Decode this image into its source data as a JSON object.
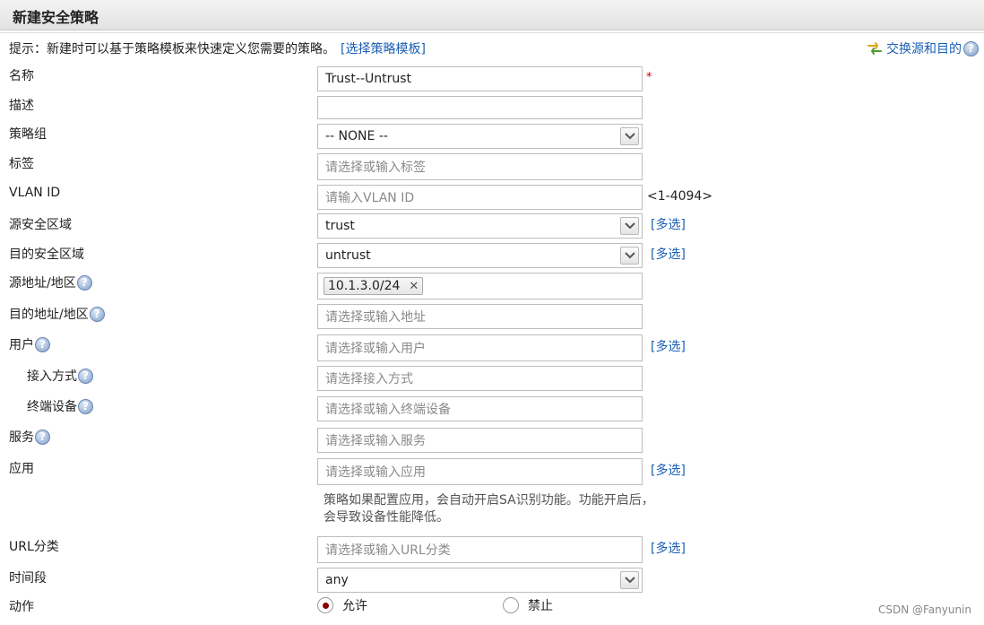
{
  "title": "新建安全策略",
  "hint": {
    "text": "提示：新建时可以基于策略模板来快速定义您需要的策略。",
    "template_link": "[选择策略模板]",
    "swap_label": "交换源和目的"
  },
  "colors": {
    "link": "#1a5fb4",
    "required": "#d00000",
    "radio_selected": "#8b0000"
  },
  "form": {
    "name": {
      "label": "名称",
      "value": "Trust--Untrust",
      "required_mark": "*"
    },
    "desc": {
      "label": "描述",
      "value": ""
    },
    "group": {
      "label": "策略组",
      "value": "-- NONE --"
    },
    "tag": {
      "label": "标签",
      "placeholder": "请选择或输入标签"
    },
    "vlan": {
      "label": "VLAN ID",
      "placeholder": "请输入VLAN ID",
      "range": "<1-4094>"
    },
    "src_zone": {
      "label": "源安全区域",
      "value": "trust",
      "multi": "[多选]"
    },
    "dst_zone": {
      "label": "目的安全区域",
      "value": "untrust",
      "multi": "[多选]"
    },
    "src_addr": {
      "label": "源地址/地区",
      "tag": "10.1.3.0/24"
    },
    "dst_addr": {
      "label": "目的地址/地区",
      "placeholder": "请选择或输入地址"
    },
    "user": {
      "label": "用户",
      "placeholder": "请选择或输入用户",
      "multi": "[多选]"
    },
    "access": {
      "label": "接入方式",
      "placeholder": "请选择接入方式"
    },
    "device": {
      "label": "终端设备",
      "placeholder": "请选择或输入终端设备"
    },
    "service": {
      "label": "服务",
      "placeholder": "请选择或输入服务"
    },
    "app": {
      "label": "应用",
      "placeholder": "请选择或输入应用",
      "multi": "[多选]",
      "note": "策略如果配置应用，会自动开启SA识别功能。功能开启后，会导致设备性能降低。"
    },
    "url": {
      "label": "URL分类",
      "placeholder": "请选择或输入URL分类",
      "multi": "[多选]"
    },
    "time": {
      "label": "时间段",
      "value": "any"
    },
    "action": {
      "label": "动作",
      "options": [
        "允许",
        "禁止"
      ],
      "selected": "允许"
    }
  },
  "help_icon_text": "?",
  "watermark": "CSDN @Fanyunin"
}
